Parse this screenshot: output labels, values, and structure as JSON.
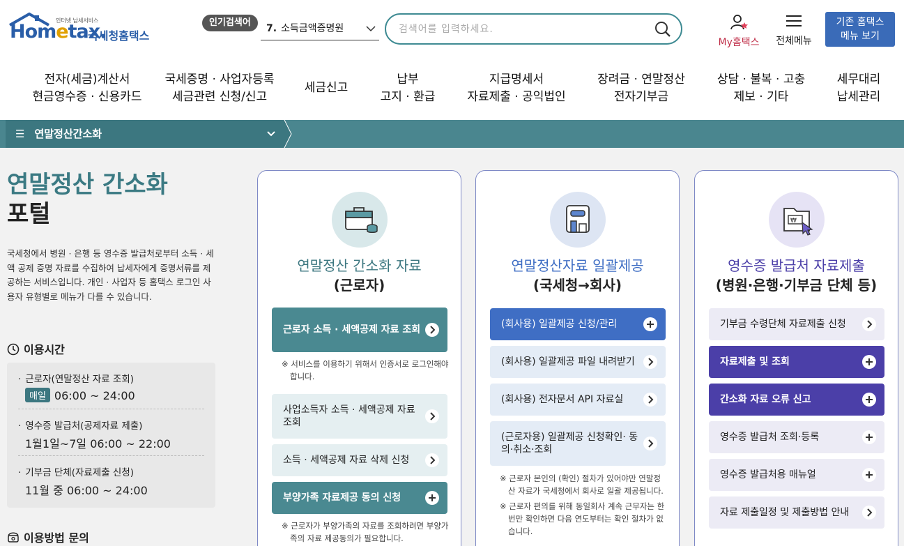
{
  "header": {
    "logo_tagline": "인터넷 납세서비스",
    "logo_brand_a": "Hom",
    "logo_brand_e": "e",
    "logo_brand_b": "tax.",
    "logo_kname": "국세청홈택스",
    "popular_tag": "인기검색어",
    "popular_num": "7.",
    "popular_term": "소득금액증명원",
    "search_placeholder": "검색어를 입력하세요.",
    "my_label": "My홈택스",
    "allmenu_label": "전체메뉴",
    "oldmenu_line1": "기존 홈택스",
    "oldmenu_line2": "메뉴 보기"
  },
  "gnb": [
    {
      "l1": "전자(세금)계산서",
      "l2": "현금영수증 · 신용카드"
    },
    {
      "l1": "국세증명 · 사업자등록",
      "l2": "세금관련 신청/신고"
    },
    {
      "l1": "세금신고",
      "l2": ""
    },
    {
      "l1": "납부",
      "l2": "고지 · 환급"
    },
    {
      "l1": "지급명세서",
      "l2": "자료제출 · 공익법인"
    },
    {
      "l1": "장려금 · 연말정산",
      "l2": "전자기부금"
    },
    {
      "l1": "상담 · 불복 · 고충",
      "l2": "제보 · 기타"
    },
    {
      "l1": "세무대리",
      "l2": "납세관리"
    }
  ],
  "breadcrumb": {
    "label": "연말정산간소화"
  },
  "intro": {
    "title1": "연말정산 간소화",
    "title2": "포털",
    "desc": "국세청에서 병원 · 은행 등 영수증 발급처로부터 소득 · 세액 공제 증명 자료를 수집하여 납세자에게 증명서류를 제공하는 서비스입니다. 개인 · 사업자 등 홈택스 로그인 사용자 유형별로 메뉴가 다를 수 있습니다.",
    "hours_heading": "이용시간",
    "hours": [
      {
        "cat": "근로자(연말정산 자료 조회)",
        "badge": "매일",
        "time": "06:00 ~ 24:00"
      },
      {
        "cat": "영수증 발급처(공제자료 제출)",
        "badge": "",
        "time": "1월1일~7일 06:00 ~ 22:00"
      },
      {
        "cat": "기부금 단체(자료제출 신청)",
        "badge": "",
        "time": "11월 중 06:00 ~ 24:00"
      }
    ],
    "contact_heading": "이용방법 문의"
  },
  "cards": [
    {
      "title_a": "연말정산 간소화 자료",
      "title_b": "(근로자)",
      "buttons": [
        "근로자 소득 · 세액공제 자료 조회",
        "사업소득자 소득 · 세액공제 자료 조회",
        "소득 · 세액공제 자료 삭제 신청",
        "부양가족 자료제공 동의 신청"
      ],
      "note1": "※ 서비스를 이용하기 위해서 인증서로 로그인해야 합니다.",
      "note2": "※ 근로자가 부양가족의 자료를 조회하려면 부양가족의 자료 제공동의가 필요합니다."
    },
    {
      "title_a": "연말정산자료 일괄제공",
      "title_b": "(국세청→회사)",
      "buttons": [
        "(회사용) 일괄제공 신청/관리",
        "(회사용) 일괄제공 파일 내려받기",
        "(회사용) 전자문서 API 자료실",
        "(근로자용) 일괄제공 신청확인· 동의·취소·조회"
      ],
      "note1": "※ 근로자 본인의 (확인) 절차가 있어야만 연말정산 자료가 국세청에서 회사로 일괄 제공됩니다.",
      "note2": "※ 근로자 편의를 위해 동일회사 계속 근무자는 한 번만 확인하면 다음 연도부터는 확인 절차가 없습니다."
    },
    {
      "title_a": "영수증 발급처 자료제출",
      "title_b": "(병원·은행·기부금 단체 등)",
      "buttons": [
        "기부금 수령단체 자료제출 신청",
        "자료제출 및 조회",
        "간소화 자료 오류 신고",
        "영수증 발급처 조회·등록",
        "영수증 발급처용 매뉴얼",
        "자료 제출일정 및 제출방법 안내"
      ]
    }
  ],
  "colors": {
    "teal": "#4a8991",
    "blue": "#3f6ec4",
    "purple": "#4b3fa8",
    "brand": "#2a5ea8"
  }
}
